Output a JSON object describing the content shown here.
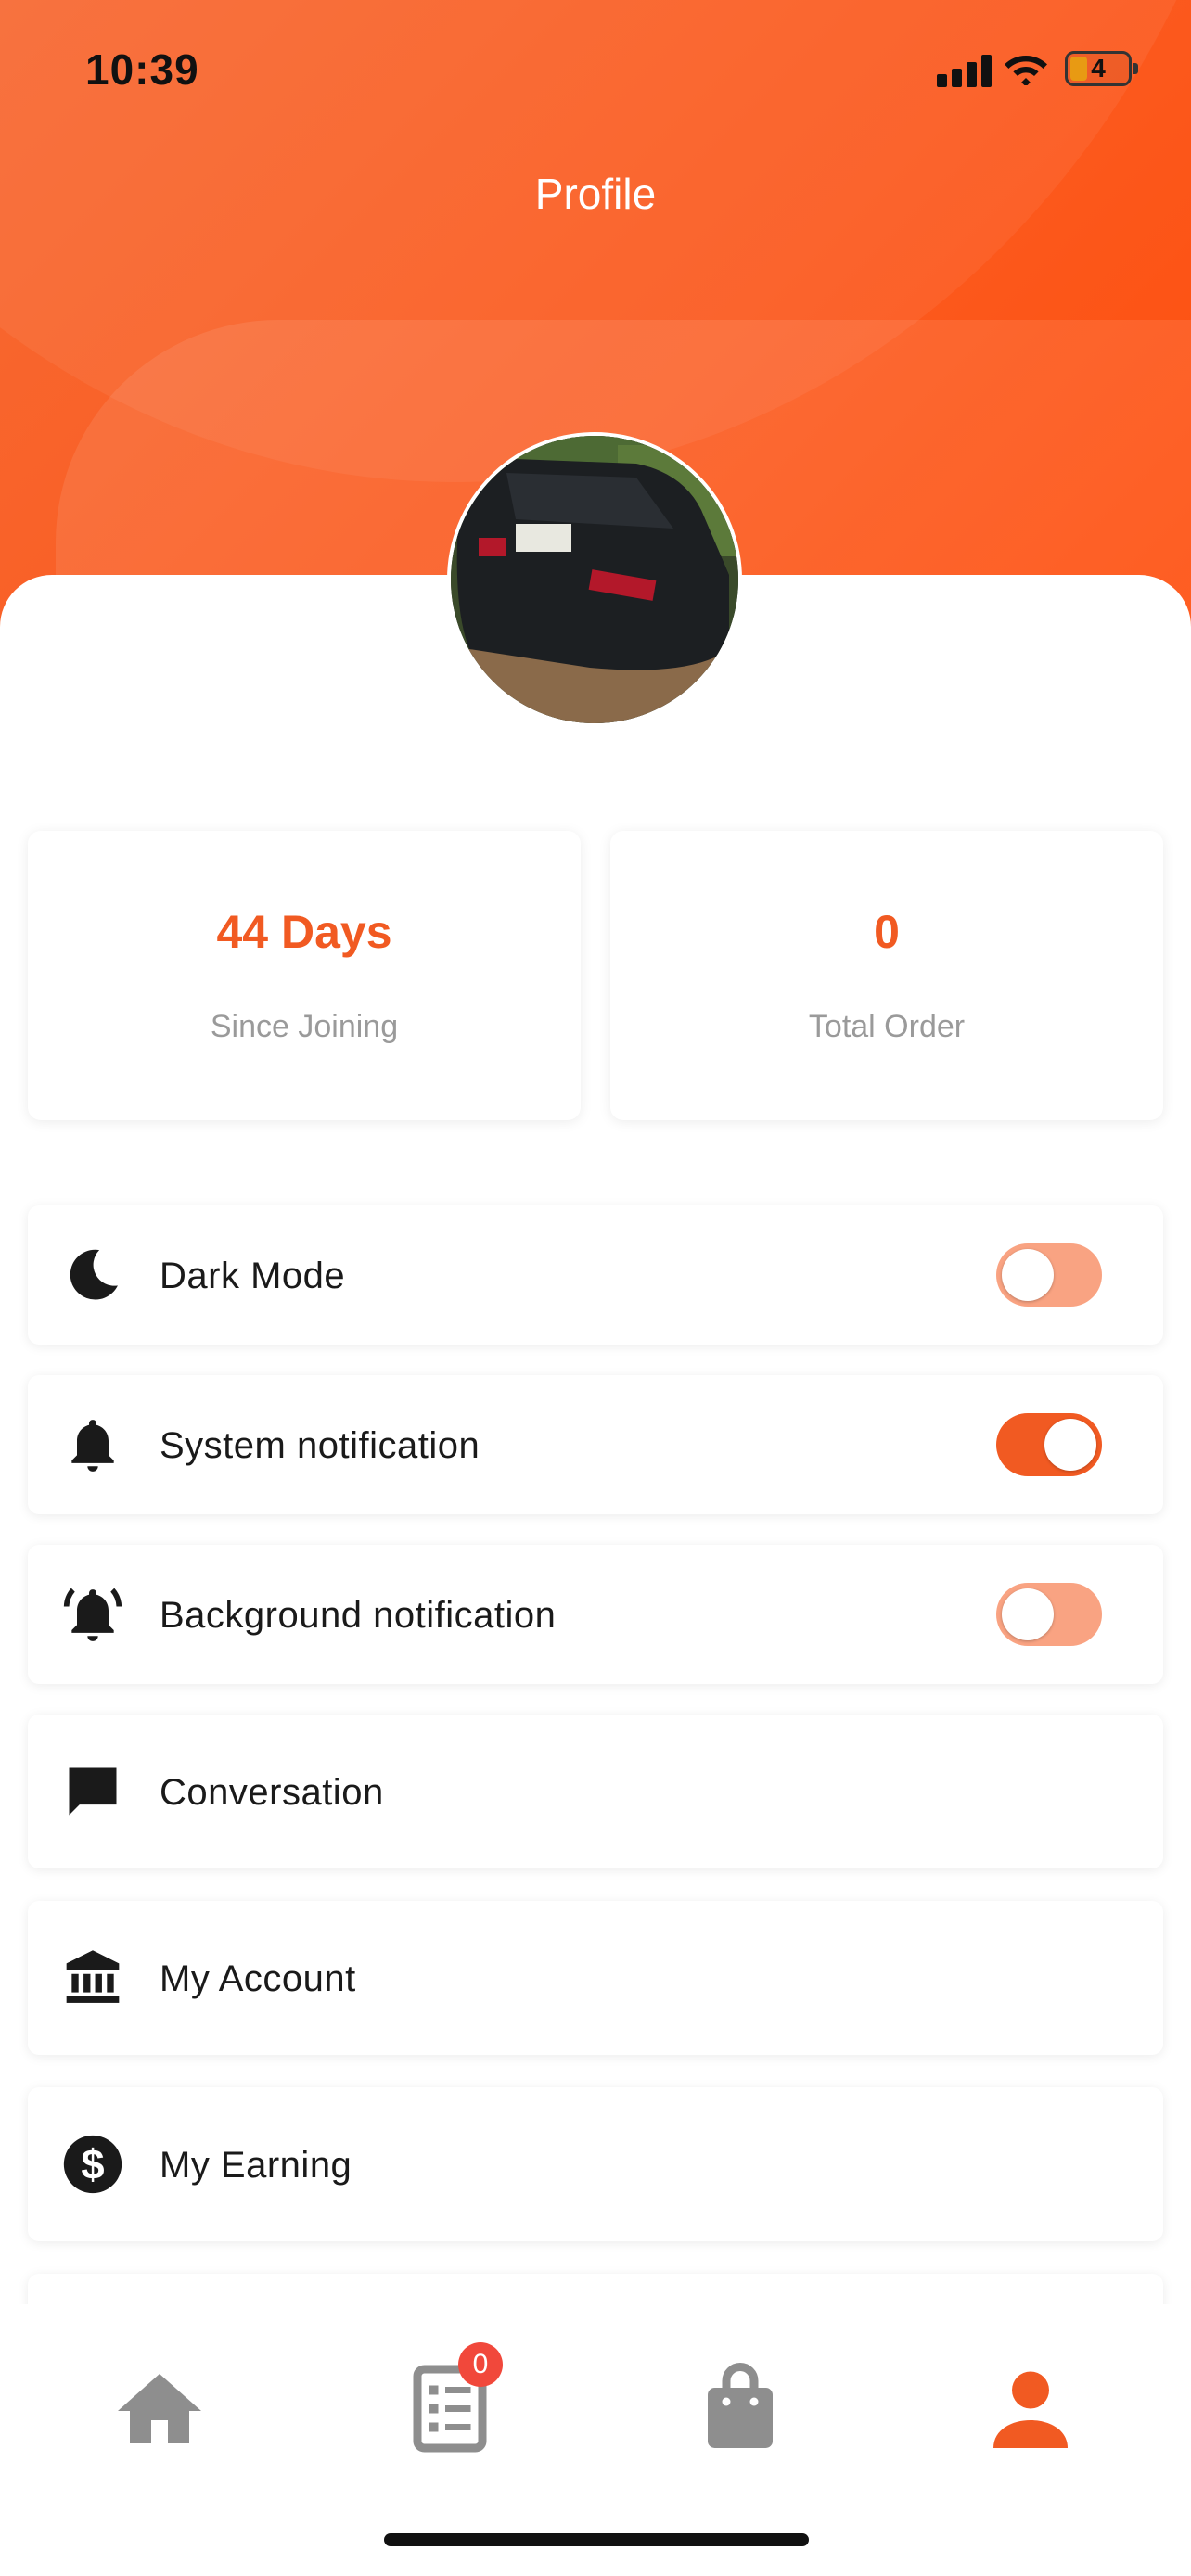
{
  "status_bar": {
    "time": "10:39",
    "battery": "4",
    "icons": [
      "signal-icon",
      "wifi-icon",
      "battery-icon"
    ]
  },
  "header": {
    "title": "Profile"
  },
  "profile": {
    "avatar": "avatar"
  },
  "stats": [
    {
      "value": "44 Days",
      "label": "Since Joining"
    },
    {
      "value": "0",
      "label": "Total Order"
    }
  ],
  "settings": [
    {
      "icon": "moon-icon",
      "label": "Dark Mode",
      "toggle": false
    },
    {
      "icon": "bell-icon",
      "label": "System notification",
      "toggle": true
    },
    {
      "icon": "bell-ringing-icon",
      "label": "Background notification",
      "toggle": false
    },
    {
      "icon": "chat-icon",
      "label": "Conversation"
    },
    {
      "icon": "bank-icon",
      "label": "My Account"
    },
    {
      "icon": "dollar-icon",
      "label": "My Earning"
    }
  ],
  "tabbar": {
    "items": [
      "home-icon",
      "orders-list-icon",
      "shopping-bag-icon",
      "profile-icon"
    ],
    "active": "profile-icon",
    "orders_badge": "0"
  },
  "colors": {
    "accent": "#f15a22",
    "toggle_off": "#f9a382",
    "badge": "#f1483b"
  }
}
